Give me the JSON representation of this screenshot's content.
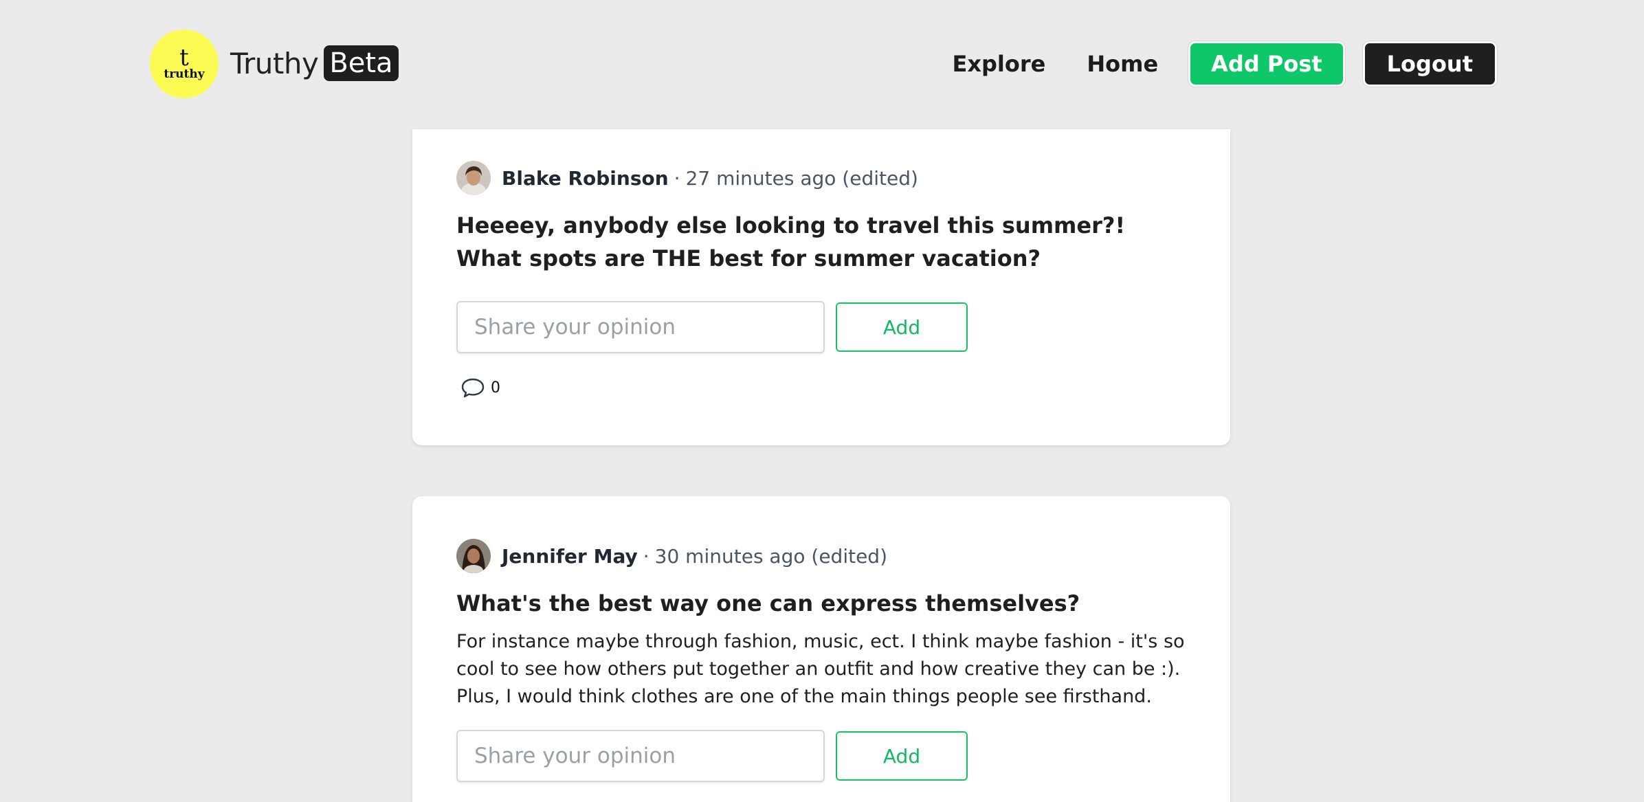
{
  "header": {
    "logo_letter": "t",
    "logo_word": "truthy",
    "brand_name": "Truthy",
    "brand_badge": "Beta",
    "nav": {
      "explore": "Explore",
      "home": "Home",
      "add_post": "Add Post",
      "logout": "Logout"
    }
  },
  "colors": {
    "background": "#ebebeb",
    "logo_yellow": "#fbfb54",
    "accent_green": "#0ec768",
    "dark": "#1f1f1f"
  },
  "posts": [
    {
      "author": "Blake Robinson",
      "separator": "·",
      "time": "27 minutes ago (edited)",
      "title": "Heeeey, anybody else looking to travel this summer?! What spots are THE best for summer vacation?",
      "body": "",
      "opinion_placeholder": "Share your opinion",
      "add_label": "Add",
      "comment_count": "0"
    },
    {
      "author": "Jennifer May",
      "separator": "·",
      "time": "30 minutes ago (edited)",
      "title": "What's the best way one can express themselves?",
      "body": "For instance maybe through fashion, music, ect. I think maybe fashion - it's so cool to see how others put together an outfit and how creative they can be :). Plus, I would think clothes are one of the main things people see firsthand.",
      "opinion_placeholder": "Share your opinion",
      "add_label": "Add"
    }
  ],
  "icons": {
    "comment": "speech-bubble-icon",
    "avatar": "user-avatar"
  }
}
